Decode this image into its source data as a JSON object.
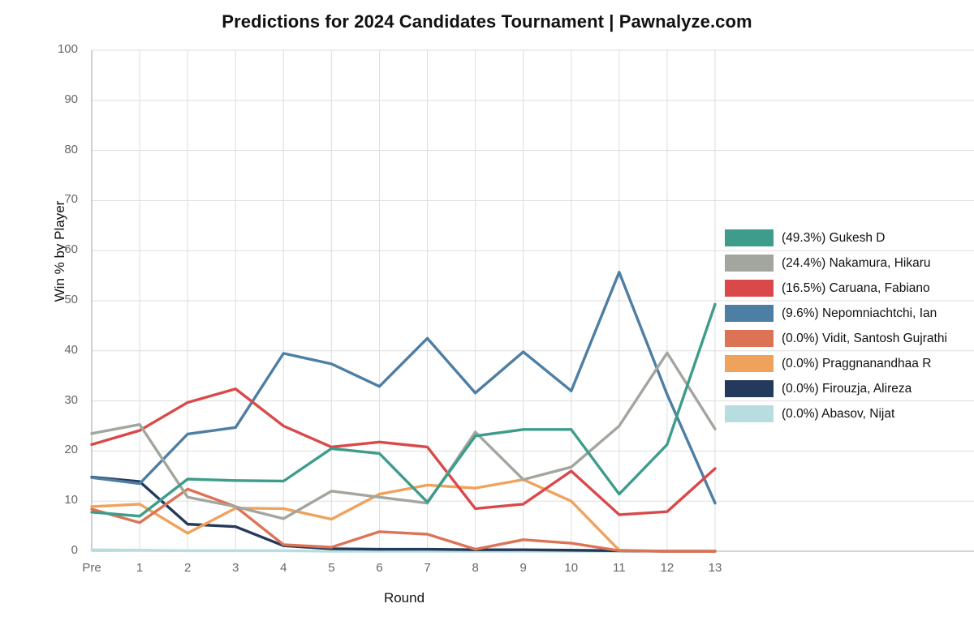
{
  "chart_data": {
    "type": "line",
    "title": "Predictions for 2024 Candidates Tournament | Pawnalyze.com",
    "xlabel": "Round",
    "ylabel": "Win % by Player",
    "categories": [
      "Pre",
      "1",
      "2",
      "3",
      "4",
      "5",
      "6",
      "7",
      "8",
      "9",
      "10",
      "11",
      "12",
      "13"
    ],
    "x_tick_labels": [
      "Pre",
      "1",
      "2",
      "3",
      "4",
      "5",
      "6",
      "7",
      "8",
      "9",
      "10",
      "11",
      "12",
      "13"
    ],
    "y_tick_labels": [
      "0",
      "10",
      "20",
      "30",
      "40",
      "50",
      "60",
      "70",
      "80",
      "90",
      "100"
    ],
    "ylim": [
      0,
      100
    ],
    "grid": true,
    "legend_position": "right",
    "series": [
      {
        "name": "Gukesh D",
        "legend_label": "(49.3%) Gukesh D",
        "final_pct": "49.3%",
        "color": "#3d9c8b",
        "values": [
          7.8,
          7.0,
          14.4,
          14.1,
          14.0,
          20.5,
          19.5,
          9.8,
          23.0,
          24.3,
          24.3,
          11.4,
          21.3,
          49.3
        ]
      },
      {
        "name": "Nakamura, Hikaru",
        "legend_label": "(24.4%) Nakamura, Hikaru",
        "final_pct": "24.4%",
        "color": "#a3a69e",
        "values": [
          23.5,
          25.3,
          10.8,
          8.9,
          6.5,
          12.0,
          10.8,
          9.6,
          23.8,
          14.3,
          16.8,
          25.0,
          39.6,
          24.4
        ]
      },
      {
        "name": "Caruana, Fabiano",
        "legend_label": "(16.5%) Caruana, Fabiano",
        "final_pct": "16.5%",
        "color": "#d9494a",
        "values": [
          21.3,
          24.1,
          29.7,
          32.4,
          25.0,
          20.8,
          21.8,
          20.8,
          8.5,
          9.4,
          16.0,
          7.3,
          7.9,
          16.5
        ]
      },
      {
        "name": "Nepomniachtchi, Ian",
        "legend_label": "(9.6%) Nepomniachtchi, Ian",
        "final_pct": "9.6%",
        "color": "#4d7ea3",
        "values": [
          14.7,
          13.5,
          23.4,
          24.7,
          39.5,
          37.4,
          32.9,
          42.5,
          31.6,
          39.8,
          32.0,
          55.7,
          31.3,
          9.6
        ]
      },
      {
        "name": "Vidit, Santosh Gujrathi",
        "legend_label": "(0.0%) Vidit, Santosh Gujrathi",
        "final_pct": "0.0%",
        "color": "#dd7355",
        "values": [
          8.4,
          5.7,
          12.4,
          8.9,
          1.3,
          0.8,
          3.9,
          3.4,
          0.4,
          2.3,
          1.6,
          0.1,
          0.0,
          0.0
        ]
      },
      {
        "name": "Praggnanandhaa R",
        "legend_label": "(0.0%) Praggnanandhaa R",
        "final_pct": "0.0%",
        "color": "#efa25c",
        "values": [
          8.9,
          9.4,
          3.6,
          8.6,
          8.5,
          6.4,
          11.4,
          13.2,
          12.6,
          14.3,
          10.0,
          0.2,
          0.0,
          0.0
        ]
      },
      {
        "name": "Firouzja, Alireza",
        "legend_label": "(0.0%) Firouzja, Alireza",
        "final_pct": "0.0%",
        "color": "#243a5c",
        "values": [
          14.8,
          13.9,
          5.4,
          4.9,
          1.1,
          0.5,
          0.4,
          0.4,
          0.3,
          0.3,
          0.2,
          0.1,
          0.0,
          0.0
        ]
      },
      {
        "name": "Abasov, Nijat",
        "legend_label": "(0.0%) Abasov, Nijat",
        "final_pct": "0.0%",
        "color": "#b7dde0",
        "values": [
          0.3,
          0.2,
          0.1,
          0.1,
          0.1,
          0.0,
          0.0,
          0.0,
          0.0,
          0.0,
          0.0,
          0.0,
          0.0,
          0.0
        ]
      }
    ]
  }
}
